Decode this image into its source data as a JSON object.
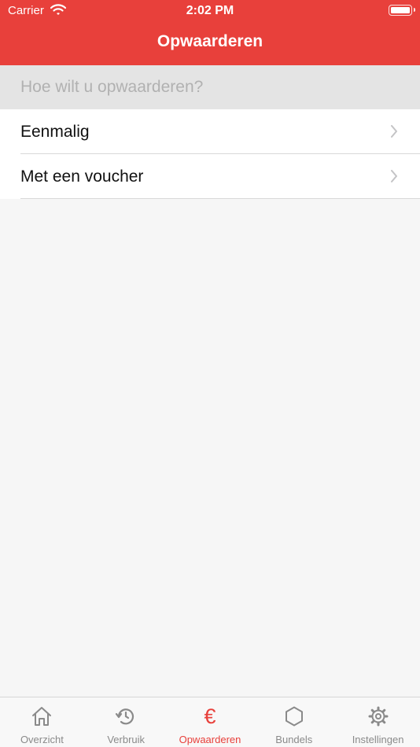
{
  "status_bar": {
    "carrier": "Carrier",
    "time": "2:02 PM"
  },
  "nav": {
    "title": "Opwaarderen"
  },
  "section": {
    "header": "Hoe wilt u opwaarderen?"
  },
  "rows": [
    {
      "label": "Eenmalig"
    },
    {
      "label": "Met een voucher"
    }
  ],
  "tabs": [
    {
      "label": "Overzicht",
      "icon": "home-icon"
    },
    {
      "label": "Verbruik",
      "icon": "history-icon"
    },
    {
      "label": "Opwaarderen",
      "icon": "euro-icon",
      "active": true
    },
    {
      "label": "Bundels",
      "icon": "hexagon-icon"
    },
    {
      "label": "Instellingen",
      "icon": "gear-icon"
    }
  ],
  "colors": {
    "accent": "#e8403b",
    "inactive": "#8a8a8a",
    "background": "#f6f6f6"
  }
}
